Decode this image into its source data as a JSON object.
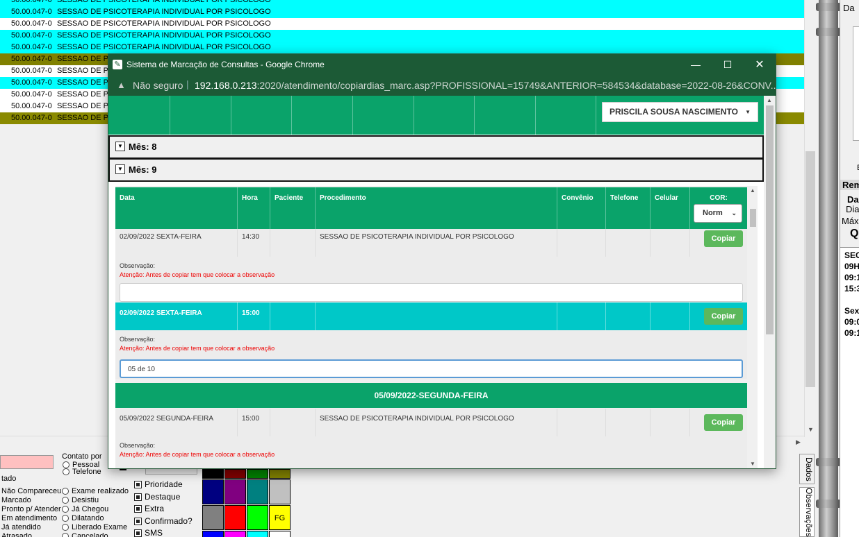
{
  "background": {
    "rows": [
      {
        "code": "50.00.047-0",
        "desc": "SESSAO DE PSICOTERAPIA INDIVIDUAL POR PSICOLOGO",
        "color": "#00ffff"
      },
      {
        "code": "50.00.047-0",
        "desc": "SESSAO DE PSICOTERAPIA INDIVIDUAL POR PSICOLOGO",
        "color": "#00ffff"
      },
      {
        "code": "50.00.047-0",
        "desc": "SESSAO DE PSICOTERAPIA INDIVIDUAL POR PSICOLOGO",
        "color": "#ffffff"
      },
      {
        "code": "50.00.047-0",
        "desc": "SESSAO DE PSICOTERAPIA INDIVIDUAL POR PSICOLOGO",
        "color": "#00ffff"
      },
      {
        "code": "50.00.047-0",
        "desc": "SESSAO DE PSICOTERAPIA INDIVIDUAL POR PSICOLOGO",
        "color": "#00ffff"
      },
      {
        "code": "50.00.047-0",
        "desc": "SESSAO DE PS",
        "color": "#808000"
      },
      {
        "code": "50.00.047-0",
        "desc": "SESSAO DE PS",
        "color": "#ffffff"
      },
      {
        "code": "50.00.047-0",
        "desc": "SESSAO DE PS",
        "color": "#00ffff"
      },
      {
        "code": "50.00.047-0",
        "desc": "SESSAO DE PS",
        "color": "#ffffff"
      },
      {
        "code": "50.00.047-0",
        "desc": "SESSAO DE PS",
        "color": "#ffffff"
      },
      {
        "code": "50.00.047-0",
        "desc": "SESSAO DE PS",
        "color": "#8a8a00"
      }
    ],
    "right_panel": {
      "top": "Da",
      "e": "E",
      "rem": "Rem",
      "da": "Da",
      "dia": "Dia",
      "max": "Máx",
      "q": "Q",
      "lines": [
        "SEC",
        "09H",
        "09:1",
        "15:3",
        "",
        "Sex",
        "09:0",
        "09:1"
      ]
    },
    "tabs": {
      "dados": "Dados",
      "observacoes": "Observações"
    },
    "contato": {
      "label": "Contato por",
      "pessoal": "Pessoal",
      "telefone": "Telefone"
    },
    "status_title": "tado",
    "status_left": [
      "Não Compareceu",
      "Marcado",
      "Pronto p/ Atender",
      "Em atendimento",
      "Já atendido",
      "Atrasado"
    ],
    "status_right": [
      "Exame realizado",
      "Desistiu",
      "Já Chegou",
      "Dilatando",
      "Liberado Exame",
      "Cancelado"
    ],
    "checkboxes": [
      "Prioridade",
      "Destaque",
      "Extra",
      "Confirmado?",
      "SMS"
    ],
    "palette_fg": "FG"
  },
  "window": {
    "title": "Sistema de Marcação de Consultas - Google Chrome",
    "insecure": "Não seguro",
    "url_host": "192.168.0.213",
    "url_rest": ":2020/atendimento/copiardias_marc.asp?PROFISSIONAL=15749&ANTERIOR=584534&database=2022-08-26&CONV..."
  },
  "page": {
    "professional": "PRISCILA SOUSA NASCIMENTO",
    "months": [
      "Mês: 8",
      "Mês: 9"
    ],
    "headers": {
      "data": "Data",
      "hora": "Hora",
      "paciente": "Paciente",
      "procedimento": "Procedimento",
      "convenio": "Convênio",
      "telefone": "Telefone",
      "celular": "Celular",
      "cor": "COR:"
    },
    "cor_value": "Norm",
    "obs_label": "Observação:",
    "obs_warning": "Atenção: Antes de copiar tem que colocar a observação",
    "copy_label": "Copiar",
    "slots": [
      {
        "date": "02/09/2022 SEXTA-FEIRA",
        "time": "14:30",
        "procedure": "SESSAO DE PSICOTERAPIA INDIVIDUAL POR PSICOLOGO",
        "obs": ""
      },
      {
        "date": "02/09/2022 SEXTA-FEIRA",
        "time": "15:00",
        "procedure": "",
        "obs": "05 de 10"
      },
      {
        "date": "05/09/2022 SEGUNDA-FEIRA",
        "time": "15:00",
        "procedure": "SESSAO DE PSICOTERAPIA INDIVIDUAL POR PSICOLOGO",
        "obs": ""
      }
    ],
    "day_header": "05/09/2022-SEGUNDA-FEIRA"
  }
}
